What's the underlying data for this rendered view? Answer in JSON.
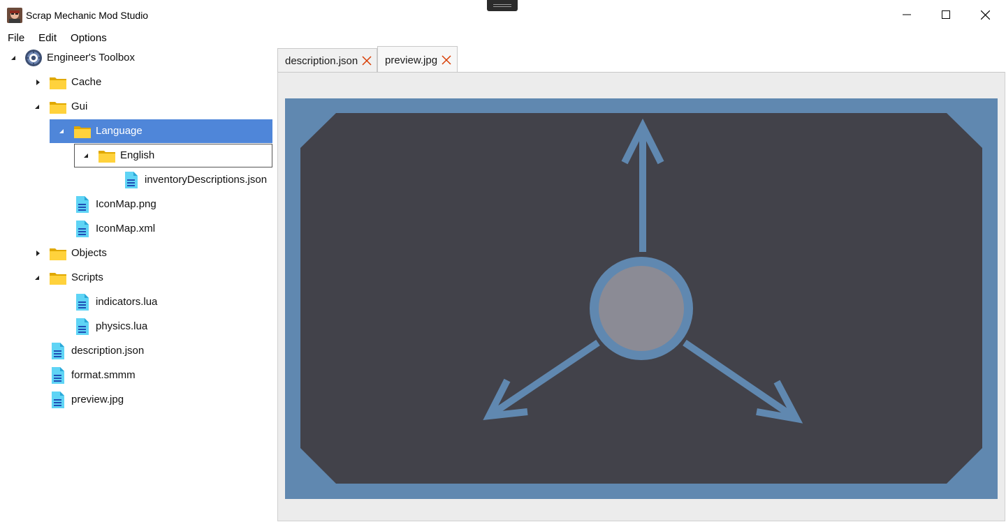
{
  "window": {
    "title": "Scrap Mechanic Mod Studio",
    "controls": {
      "minimize": "minimize-icon",
      "maximize": "maximize-icon",
      "close": "close-icon"
    }
  },
  "menu": {
    "items": [
      "File",
      "Edit",
      "Options"
    ]
  },
  "tree": {
    "root": "Engineer's Toolbox",
    "nodes": [
      {
        "label": "Cache",
        "type": "folder",
        "expanded": false
      },
      {
        "label": "Gui",
        "type": "folder",
        "expanded": true
      },
      {
        "label": "Language",
        "type": "folder",
        "expanded": true,
        "selected": true
      },
      {
        "label": "English",
        "type": "folder",
        "expanded": true,
        "focused": true
      },
      {
        "label": "inventoryDescriptions.json",
        "type": "file"
      },
      {
        "label": "IconMap.png",
        "type": "file"
      },
      {
        "label": "IconMap.xml",
        "type": "file"
      },
      {
        "label": "Objects",
        "type": "folder",
        "expanded": false
      },
      {
        "label": "Scripts",
        "type": "folder",
        "expanded": true
      },
      {
        "label": "indicators.lua",
        "type": "file"
      },
      {
        "label": "physics.lua",
        "type": "file"
      },
      {
        "label": "description.json",
        "type": "file"
      },
      {
        "label": "format.smmm",
        "type": "file"
      },
      {
        "label": "preview.jpg",
        "type": "file"
      }
    ]
  },
  "tabs": [
    {
      "label": "description.json",
      "active": false
    },
    {
      "label": "preview.jpg",
      "active": true
    }
  ],
  "colors": {
    "selection": "#4f86d9",
    "folder": "#f2c01e",
    "file": "#3fc0e8",
    "tab_close": "#d83b01",
    "preview_frame": "#6088b0",
    "preview_panel": "#42424a",
    "preview_circle": "#8b8b95"
  }
}
